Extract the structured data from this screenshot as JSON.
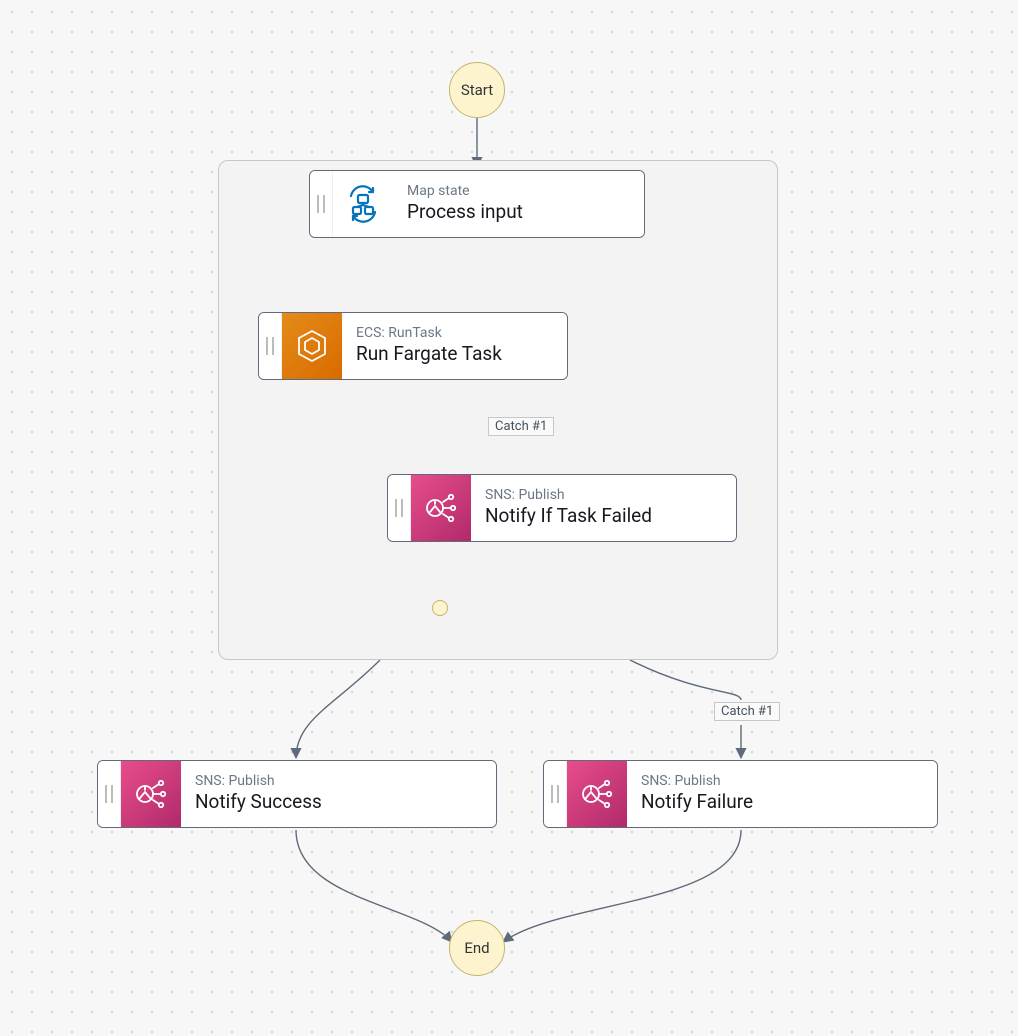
{
  "terminals": {
    "start_label": "Start",
    "end_label": "End"
  },
  "labels": {
    "catch1": "Catch #1",
    "catch2": "Catch #1"
  },
  "nodes": {
    "map": {
      "subtitle": "Map state",
      "title": "Process input",
      "icon": "map-icon"
    },
    "fargate": {
      "subtitle": "ECS: RunTask",
      "title": "Run Fargate Task",
      "icon": "ecs-icon"
    },
    "notify_failed": {
      "subtitle": "SNS: Publish",
      "title": "Notify If Task Failed",
      "icon": "sns-icon"
    },
    "notify_success": {
      "subtitle": "SNS: Publish",
      "title": "Notify Success",
      "icon": "sns-icon"
    },
    "notify_failure": {
      "subtitle": "SNS: Publish",
      "title": "Notify Failure",
      "icon": "sns-icon"
    }
  }
}
